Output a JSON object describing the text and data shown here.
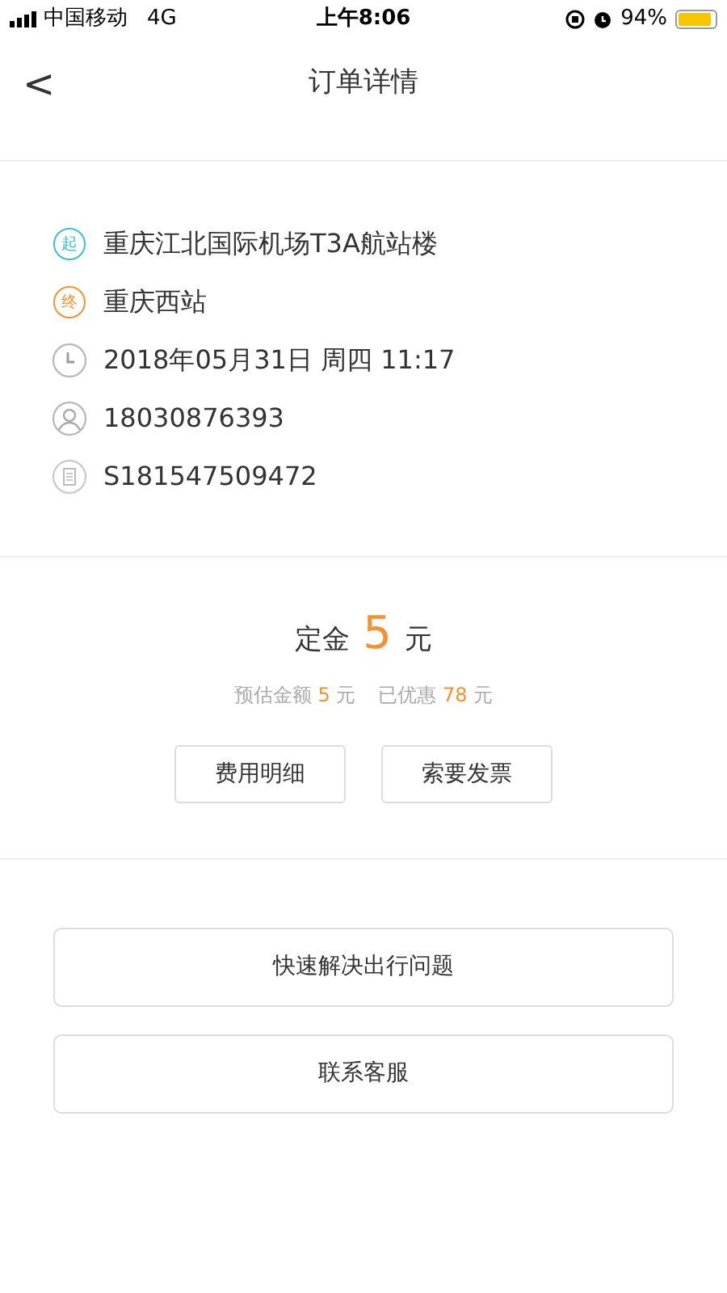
{
  "status_bar": {
    "carrier": "中国移动",
    "network": "4G",
    "time": "上午8:06",
    "battery": "94%"
  },
  "header": {
    "back": "<",
    "title": "订单详情"
  },
  "details": [
    {
      "kind": "start",
      "badge": "起",
      "text": "重庆江北国际机场T3A航站楼"
    },
    {
      "kind": "end",
      "badge": "终",
      "text": "重庆西站"
    },
    {
      "kind": "time",
      "text": "2018年05月31日 周四 11:17"
    },
    {
      "kind": "phone",
      "text": "18030876393"
    },
    {
      "kind": "order",
      "text": "S181547509472"
    }
  ],
  "deposit": {
    "label": "定金",
    "amount": "5",
    "unit": "元"
  },
  "summary": [
    {
      "label": "预估金额",
      "amount": "5",
      "unit": "元"
    },
    {
      "label": "已优惠",
      "amount": "78",
      "unit": "元"
    }
  ],
  "fee_buttons": [
    "费用明细",
    "索要发票"
  ],
  "actions": [
    "快速解决出行问题",
    "联系客服"
  ]
}
